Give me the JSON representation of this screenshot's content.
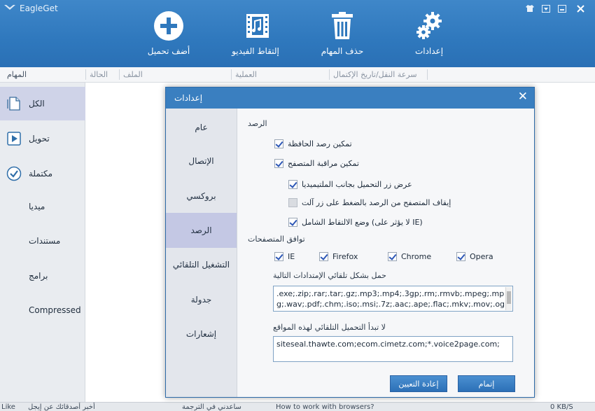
{
  "window": {
    "title": "EagleGet"
  },
  "window_buttons": [
    {
      "name": "skin-icon",
      "glyph": "♦"
    },
    {
      "name": "menu-icon",
      "glyph": "▾"
    },
    {
      "name": "minimize-icon",
      "glyph": "—"
    },
    {
      "name": "close-icon",
      "glyph": "✕"
    }
  ],
  "toolbar": {
    "add_download": "أضف تحميل",
    "capture_video": "إلتقاط الفيديو",
    "delete_tasks": "حذف المهام",
    "settings": "إعدادات"
  },
  "columns": {
    "tasks": "المهام",
    "status": "الحالة",
    "file": "الملف",
    "process": "العملية",
    "speed_date": "سرعة النقل/تاريخ الإكتمال"
  },
  "sidebar": {
    "items": [
      {
        "label": "الكل",
        "icon": "document-icon"
      },
      {
        "label": "تحويل",
        "icon": "play-icon"
      },
      {
        "label": "مكتملة",
        "icon": "check-circle-icon"
      },
      {
        "label": "ميديا",
        "icon": ""
      },
      {
        "label": "مستندات",
        "icon": ""
      },
      {
        "label": "برامج",
        "icon": ""
      },
      {
        "label": "Compressed",
        "icon": ""
      }
    ]
  },
  "dialog": {
    "title": "إعدادات",
    "nav": [
      "عام",
      "الإتصال",
      "بروكسي",
      "الرصد",
      "التشغيل التلقائي",
      "جدولة",
      "إشعارات"
    ],
    "monitoring": {
      "section": "الرصد",
      "clipboard": "تمكين رصد الحافظة",
      "browser": "تمكين مراقبة المتصفح",
      "show_button": "عرض زر التحميل بجانب الملتيميديا",
      "stop_alt": "إيقاف المتصفح من الرصد بالضغط على زر آلت",
      "sniffing": "وضع الالتقاط الشامل (لا يؤثر على IE)"
    },
    "compat": {
      "section": "توافق المتصفحات",
      "browsers": [
        "IE",
        "Firefox",
        "Chrome",
        "Opera"
      ]
    },
    "extensions": {
      "label": "حمل بشكل تلقائي الإمتدادات التالية",
      "value": ".exe;.zip;.rar;.tar;.gz;.mp3;.mp4;.3gp;.rm;.rmvb;.mpeg;.mpg;.wav;.pdf;.chm;.iso;.msi;.7z;.aac;.ape;.flac;.mkv;.mov;.ogg;.torrent;"
    },
    "sites": {
      "label": "لا تبدأ التحميل التلقائي لهذه المواقع",
      "value": "siteseal.thawte.com;ecom.cimetz.com;*.voice2page.com;"
    },
    "buttons": {
      "reset": "إعادة التعيين",
      "ok": "إتمام"
    }
  },
  "statusbar": {
    "like": "Like",
    "left_text": "أخبر أصدقائك عن إيجل",
    "middle_text": "ساعدني في الترجمة",
    "tip": "How to work with browsers?",
    "speed": "0 KB/S"
  }
}
